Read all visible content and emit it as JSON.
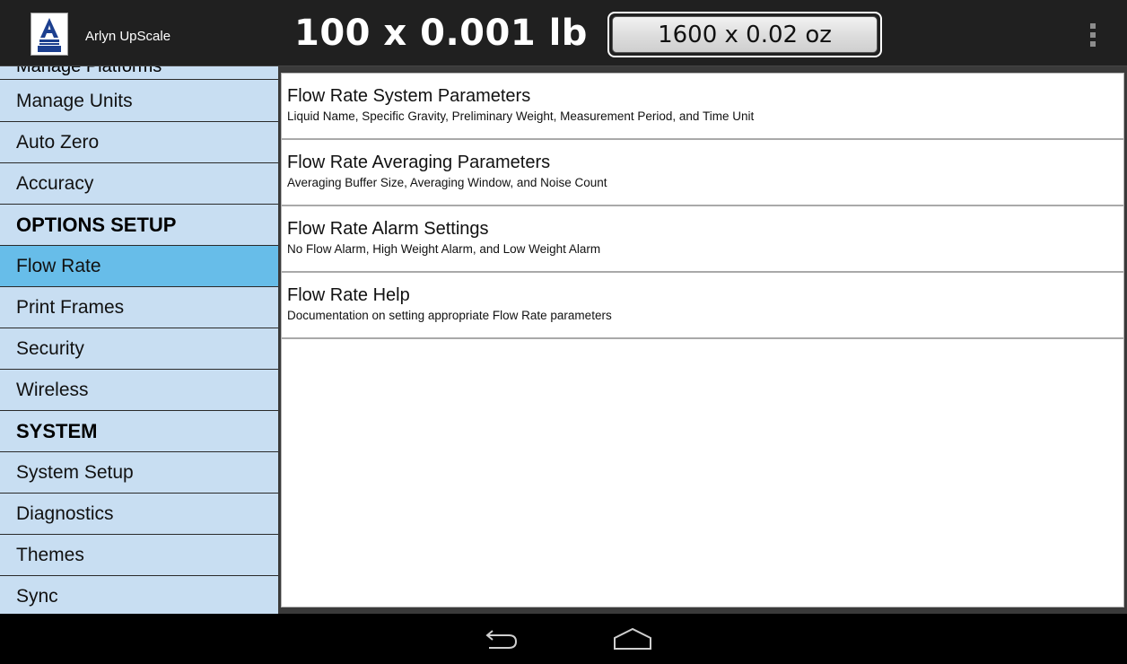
{
  "app": {
    "title": "Arlyn UpScale",
    "logo_text": "ARLYN",
    "main_weight": "100 x 0.001 lb",
    "secondary_weight": "1600 x 0.02 oz"
  },
  "sidebar": {
    "cutoff_label": "Manage Platforms",
    "items": [
      {
        "label": "Manage Units",
        "type": "item"
      },
      {
        "label": "Auto Zero",
        "type": "item"
      },
      {
        "label": "Accuracy",
        "type": "item"
      },
      {
        "label": "OPTIONS SETUP",
        "type": "header"
      },
      {
        "label": "Flow Rate",
        "type": "item",
        "selected": true
      },
      {
        "label": "Print Frames",
        "type": "item"
      },
      {
        "label": "Security",
        "type": "item"
      },
      {
        "label": "Wireless",
        "type": "item"
      },
      {
        "label": "SYSTEM",
        "type": "header"
      },
      {
        "label": "System Setup",
        "type": "item"
      },
      {
        "label": "Diagnostics",
        "type": "item"
      },
      {
        "label": "Themes",
        "type": "item"
      },
      {
        "label": "Sync",
        "type": "item"
      }
    ]
  },
  "content": {
    "items": [
      {
        "title": "Flow Rate System Parameters",
        "subtitle": "Liquid Name, Specific Gravity, Preliminary Weight, Measurement Period, and Time Unit"
      },
      {
        "title": "Flow Rate Averaging Parameters",
        "subtitle": "Averaging Buffer Size, Averaging Window, and Noise Count"
      },
      {
        "title": "Flow Rate Alarm Settings",
        "subtitle": "No Flow Alarm, High Weight Alarm, and Low Weight Alarm"
      },
      {
        "title": "Flow Rate Help",
        "subtitle": "Documentation on setting appropriate Flow Rate parameters"
      }
    ]
  },
  "nav": {
    "icons": [
      "back-icon",
      "home-icon"
    ]
  },
  "colors": {
    "action_bar": "#202020",
    "sidebar_bg": "#c8def2",
    "sidebar_selected": "#67bde9",
    "content_bg": "#ffffff",
    "nav_bar": "#000000"
  }
}
